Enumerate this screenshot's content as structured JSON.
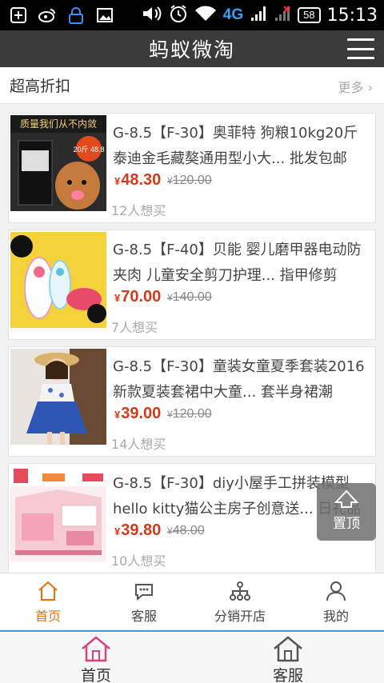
{
  "status_bar": {
    "network": "4G",
    "battery": "58",
    "time": "15:13"
  },
  "header": {
    "title": "蚂蚁微淘"
  },
  "section": {
    "title": "超高折扣",
    "more": "更多"
  },
  "products": [
    {
      "name": "G-8.5【F-30】奥菲特 狗粮10kg20斤泰迪金毛藏獒通用型小大... 批发包邮",
      "currency": "¥",
      "price": "48.30",
      "original_price": "120.00",
      "wants": "12人想买",
      "thumb_text": "质量我们从不内敛",
      "thumb_badge": "20斤 48.8"
    },
    {
      "name": "G-8.5【F-40】贝能 婴儿磨甲器电动防夹肉 儿童安全剪刀护理... 指甲修剪",
      "currency": "¥",
      "price": "70.00",
      "original_price": "140.00",
      "wants": "7人想买",
      "thumb_text": "",
      "thumb_badge": ""
    },
    {
      "name": "G-8.5【F-30】童装女童夏季套装2016新款夏装套裙中大童... 套半身裙潮",
      "currency": "¥",
      "price": "39.00",
      "original_price": "120.00",
      "wants": "14人想买",
      "thumb_text": "",
      "thumb_badge": ""
    },
    {
      "name": "G-8.5【F-30】diy小屋手工拼装模型hello kitty猫公主房子创意送... 日礼品",
      "currency": "¥",
      "price": "39.80",
      "original_price": "48.00",
      "wants": "10人想买",
      "thumb_text": "",
      "thumb_badge": ""
    }
  ],
  "back_to_top": "置顶",
  "web_nav": [
    {
      "label": "首页",
      "icon": "home-icon",
      "active": true
    },
    {
      "label": "客服",
      "icon": "chat-icon",
      "active": false
    },
    {
      "label": "分销开店",
      "icon": "network-icon",
      "active": false
    },
    {
      "label": "我的",
      "icon": "user-icon",
      "active": false
    }
  ],
  "app_tabs": [
    {
      "label": "首页",
      "icon": "home-icon"
    },
    {
      "label": "客服",
      "icon": "service-home-icon"
    }
  ],
  "colors": {
    "title_bar": "#3b3b3b",
    "price": "#d23b1b",
    "active_nav": "#e8710a",
    "app_tab_border": "#2fa3d8"
  }
}
